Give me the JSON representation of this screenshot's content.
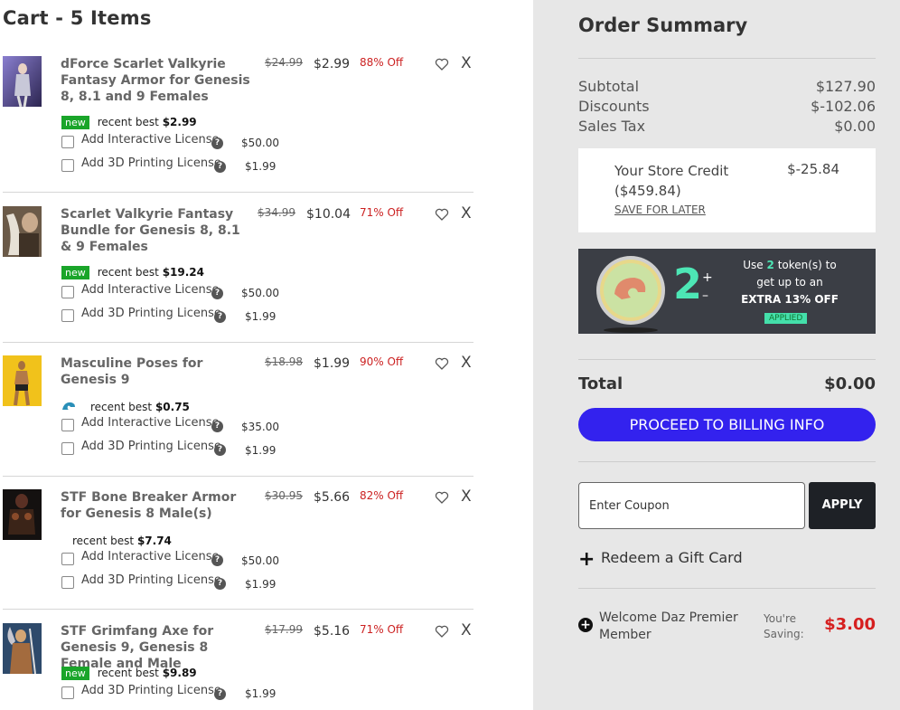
{
  "cart": {
    "title": "Cart - 5 Items",
    "items": [
      {
        "name": "dForce Scarlet Valkyrie Fantasy Armor for Genesis 8, 8.1 and 9 Females",
        "original_price": "$24.99",
        "price": "$2.99",
        "discount": "88% Off",
        "badge": "new",
        "recent_best_label": "recent best",
        "recent_best_price": "$2.99",
        "options": [
          {
            "label": "Add Interactive License",
            "price": "$50.00"
          },
          {
            "label": "Add 3D Printing License",
            "price": "$1.99"
          }
        ]
      },
      {
        "name": "Scarlet Valkyrie Fantasy Bundle for Genesis 8, 8.1 & 9 Females",
        "original_price": "$34.99",
        "price": "$10.04",
        "discount": "71% Off",
        "badge": "new",
        "recent_best_label": "recent best",
        "recent_best_price": "$19.24",
        "options": [
          {
            "label": "Add Interactive License",
            "price": "$50.00"
          },
          {
            "label": "Add 3D Printing License",
            "price": "$1.99"
          }
        ]
      },
      {
        "name": "Masculine Poses for Genesis 9",
        "original_price": "$18.98",
        "price": "$1.99",
        "discount": "90% Off",
        "badge": "",
        "recent_best_label": "recent best",
        "recent_best_price": "$0.75",
        "options": [
          {
            "label": "Add Interactive License",
            "price": "$35.00"
          },
          {
            "label": "Add 3D Printing License",
            "price": "$1.99"
          }
        ]
      },
      {
        "name": "STF Bone Breaker Armor for Genesis 8 Male(s)",
        "original_price": "$30.95",
        "price": "$5.66",
        "discount": "82% Off",
        "badge": "",
        "recent_best_label": "recent best",
        "recent_best_price": "$7.74",
        "options": [
          {
            "label": "Add Interactive License",
            "price": "$50.00"
          },
          {
            "label": "Add 3D Printing License",
            "price": "$1.99"
          }
        ]
      },
      {
        "name": "STF Grimfang Axe for Genesis 9, Genesis 8 Female and Male",
        "original_price": "$17.99",
        "price": "$5.16",
        "discount": "71% Off",
        "badge": "new",
        "recent_best_label": "recent best",
        "recent_best_price": "$9.89",
        "options": [
          {
            "label": "Add 3D Printing License",
            "price": "$1.99"
          }
        ]
      }
    ],
    "remove_label": "X",
    "help_glyph": "?"
  },
  "summary": {
    "title": "Order Summary",
    "subtotal_label": "Subtotal",
    "subtotal": "$127.90",
    "discounts_label": "Discounts",
    "discounts": "$-102.06",
    "tax_label": "Sales Tax",
    "tax": "$0.00",
    "credit_label": "Your Store Credit ($459.84)",
    "credit_value": "$-25.84",
    "save_later": "SAVE FOR LATER",
    "token": {
      "count": "2",
      "plus": "+",
      "minus": "–",
      "line1_a": "Use",
      "line1_num": "2",
      "line1_b": "token(s) to",
      "line2": "get up to an",
      "line3": "EXTRA 13% OFF",
      "applied": "APPLIED"
    },
    "total_label": "Total",
    "total": "$0.00",
    "proceed_label": "PROCEED TO BILLING INFO",
    "coupon_placeholder": "Enter Coupon",
    "apply_label": "APPLY",
    "gift_label": "Redeem a Gift Card",
    "member_label": "Welcome Daz Premier Member",
    "saving_label": "You're Saving:",
    "saving_amount": "$3.00",
    "colors": {
      "accent": "#3322ee",
      "discount_red": "#cc2222",
      "token_green": "#4de6b5",
      "badge_green": "#1aa52a"
    }
  }
}
